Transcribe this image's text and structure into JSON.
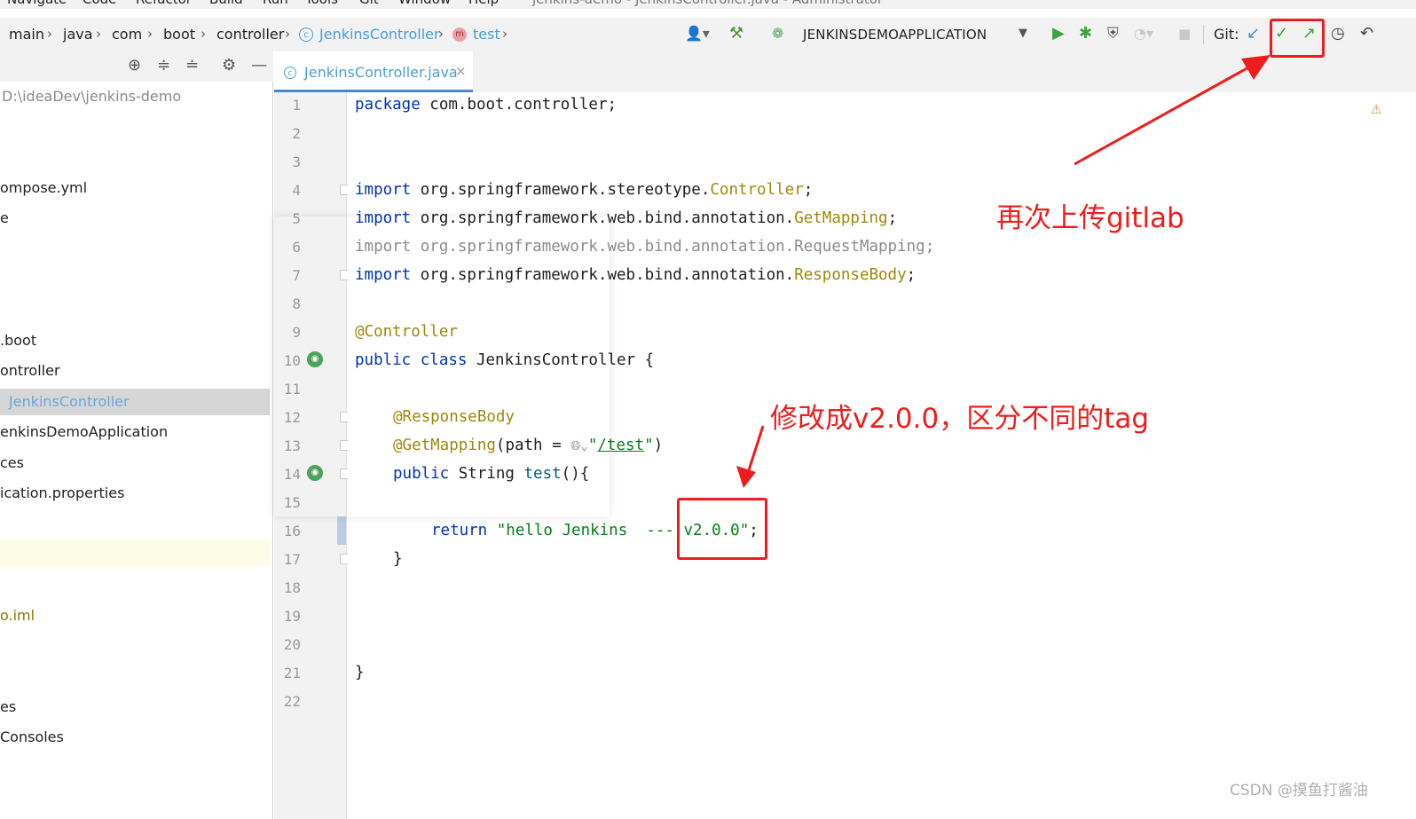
{
  "menu": {
    "items": [
      "Navigate",
      "Code",
      "Refactor",
      "Build",
      "Run",
      "Tools",
      "Git",
      "Window",
      "Help"
    ],
    "window_title": "jenkins-demo - JenkinsController.java - Administrator"
  },
  "breadcrumb": [
    "main",
    "java",
    "com",
    "boot",
    "controller",
    "JenkinsController",
    "test"
  ],
  "toolbar": {
    "run_config": "JENKINSDEMOAPPLICATION",
    "git_label": "Git:",
    "colors": {
      "run": "#3da341",
      "git_update": "#3d8fd6",
      "git_commit": "#3da341",
      "git_push": "#3da341"
    }
  },
  "project": {
    "path": "D:\\ideaDev\\jenkins-demo",
    "items": [
      "ompose.yml",
      "e",
      ".boot",
      "ontroller",
      "JenkinsController",
      "enkinsDemoApplication",
      "ces",
      "ication.properties",
      "o.iml",
      "es",
      "Consoles"
    ]
  },
  "tab": {
    "label": "JenkinsController.java"
  },
  "editor": {
    "line_numbers": [
      "1",
      "2",
      "3",
      "4",
      "5",
      "6",
      "7",
      "8",
      "9",
      "10",
      "11",
      "12",
      "13",
      "14",
      "15",
      "16",
      "17",
      "18",
      "19",
      "20",
      "21",
      "22"
    ],
    "code": {
      "l1_kw": "package",
      "l1_rest": " com.boot.controller;",
      "l4_kw": "import",
      "l4_pkg": " org.springframework.stereotype.",
      "l4_cls": "Controller",
      "l5_kw": "import",
      "l5_pkg": " org.springframework.web.bind.annotation.",
      "l5_cls": "GetMapping",
      "l6": "import org.springframework.web.bind.annotation.RequestMapping;",
      "l7_kw": "import",
      "l7_pkg": " org.springframework.web.bind.annotation.",
      "l7_cls": "ResponseBody",
      "l9": "@Controller",
      "l10_kw": "public class",
      "l10_rest": " JenkinsController {",
      "l12": "@ResponseBody",
      "l13_ann": "@GetMapping",
      "l13_mid": "(path = ",
      "l13_str_open": "\"",
      "l13_url": "/test",
      "l13_str_close": "\"",
      "l13_end": ")",
      "l14_kw": "public",
      "l14_mid": " String ",
      "l14_fn": "test",
      "l14_end": "(){",
      "l16_kw": "return",
      "l16_str": " \"hello Jenkins  --- v2.0.0\"",
      "l16_end": ";",
      "l17": "}",
      "l21": "}",
      "semi": ";"
    }
  },
  "annotations": {
    "upload_note": "再次上传gitlab",
    "version_note": "修改成v2.0.0，区分不同的tag",
    "color": "#ee1d1d"
  },
  "watermark": "CSDN @摸鱼打酱油"
}
